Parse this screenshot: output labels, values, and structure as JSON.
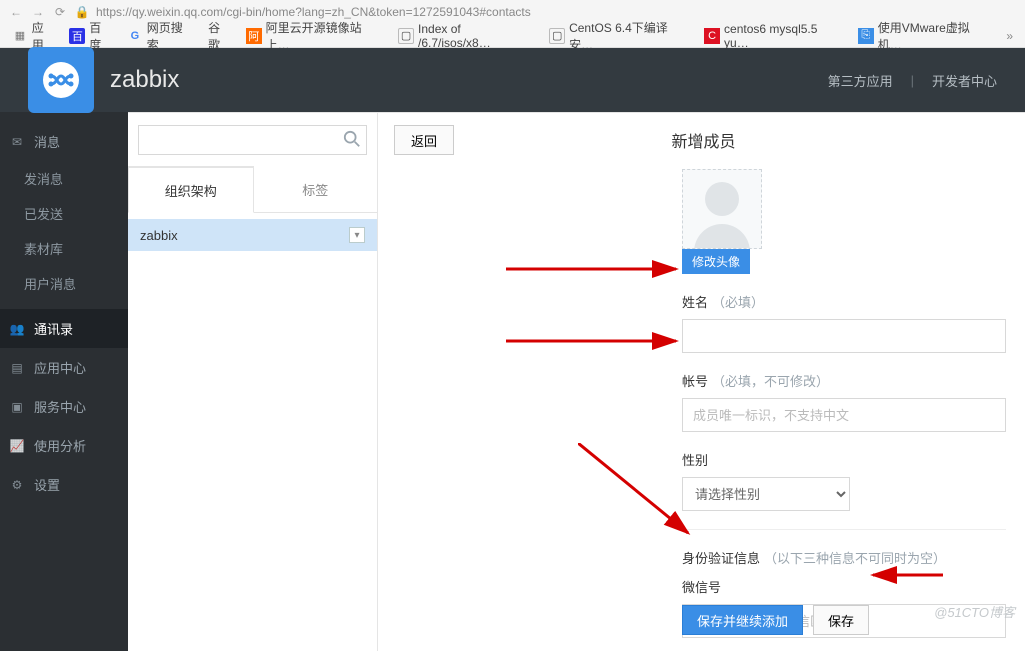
{
  "browser": {
    "url": "https://qy.weixin.qq.com/cgi-bin/home?lang=zh_CN&token=1272591043#contacts",
    "bookmarks": {
      "apps": "应用",
      "baidu": "百度",
      "websearch": "网页搜索",
      "google": "谷歌",
      "ali": "阿里云开源镜像站上…",
      "indexof": "Index of /6.7/isos/x8…",
      "centos64": "CentOS 6.4下编译安…",
      "centos6mysql": "centos6 mysql5.5 yu…",
      "vmware": "使用VMware虚拟机…"
    }
  },
  "header": {
    "brand": "zabbix",
    "right1": "第三方应用",
    "right2": "开发者中心"
  },
  "sidebar": {
    "msg_hdr": "消息",
    "msg_items": [
      "发消息",
      "已发送",
      "素材库",
      "用户消息"
    ],
    "contacts": "通讯录",
    "appcenter": "应用中心",
    "service": "服务中心",
    "analysis": "使用分析",
    "settings": "设置"
  },
  "left_panel": {
    "tab_org": "组织架构",
    "tab_tag": "标签",
    "tree_item": "zabbix"
  },
  "detail": {
    "back": "返回",
    "title": "新增成员",
    "avatar_btn": "修改头像",
    "name_label": "姓名",
    "required": "（必填）",
    "account_label": "帐号",
    "account_hint": "（必填，不可修改）",
    "account_placeholder": "成员唯一标识，不支持中文",
    "gender_label": "性别",
    "gender_placeholder": "请选择性别",
    "idinfo_label": "身份验证信息",
    "idinfo_hint": "（以下三种信息不可同时为空）",
    "wechat_label": "微信号",
    "wechat_placeholder": "允许员工扫描的微信匹配关注",
    "save_continue": "保存并继续添加",
    "save": "保存"
  },
  "watermark": "@51CTO博客"
}
